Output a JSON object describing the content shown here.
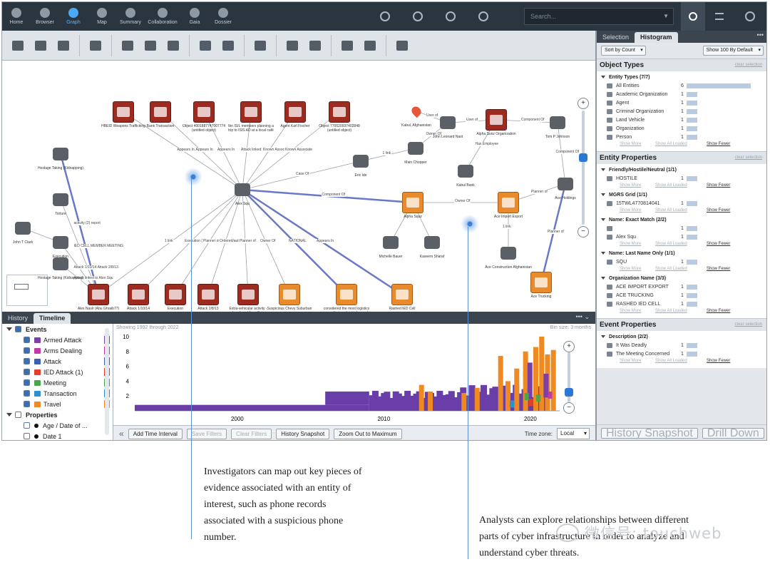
{
  "nav": {
    "items": [
      {
        "label": "Home",
        "icon": "home-icon"
      },
      {
        "label": "Browser",
        "icon": "browser-icon"
      },
      {
        "label": "Graph",
        "icon": "graph-icon",
        "active": true
      },
      {
        "label": "Map",
        "icon": "map-icon"
      },
      {
        "label": "Summary",
        "icon": "summary-icon"
      },
      {
        "label": "Collaboration",
        "icon": "collaboration-icon"
      },
      {
        "label": "Gaia",
        "icon": "gaia-icon"
      },
      {
        "label": "Dossier",
        "icon": "dossier-icon"
      }
    ],
    "search_placeholder": "Search..."
  },
  "graph": {
    "nodes": [
      {
        "id": "n1",
        "label": "HBEID Weapons Trafficking",
        "style": "red"
      },
      {
        "id": "n2",
        "label": "Bank Transaction",
        "style": "red"
      },
      {
        "id": "n3",
        "label": "Object 4001887747007774 (untitled object)",
        "style": "red"
      },
      {
        "id": "n4",
        "label": "Ibn ISIL members planning a trip to ISIS AD at a local café",
        "style": "red"
      },
      {
        "id": "n5",
        "label": "Agent Karl Fischer",
        "style": "red"
      },
      {
        "id": "n6",
        "label": "Object 770020937402848 (untitled object)",
        "style": "red"
      },
      {
        "id": "n7",
        "label": "Kabul, Afghanistan",
        "style": "pin"
      },
      {
        "id": "n8",
        "label": "John Leonard Nast",
        "style": "gray"
      },
      {
        "id": "n9",
        "label": "Alpha Sunz Organization",
        "style": "red"
      },
      {
        "id": "n10",
        "label": "Tom P Johnson",
        "style": "gray"
      },
      {
        "id": "n11",
        "label": "Main Chopper",
        "style": "gray"
      },
      {
        "id": "n12",
        "label": "Eric Ide",
        "style": "gray"
      },
      {
        "id": "n13",
        "label": "Kabul Bank",
        "style": "gray"
      },
      {
        "id": "n14",
        "label": "Ace Holdings",
        "style": "gray"
      },
      {
        "id": "n15",
        "label": "Hostage Taking (Kidnapping)",
        "style": "gray"
      },
      {
        "id": "n16",
        "label": "Torture",
        "style": "gray"
      },
      {
        "id": "n17",
        "label": "John T Clark",
        "style": "gray"
      },
      {
        "id": "n18",
        "label": "Execution",
        "style": "gray"
      },
      {
        "id": "n19",
        "label": "Hostage Taking (Kidnapping)",
        "style": "gray"
      },
      {
        "id": "n20",
        "label": "Alex Squ",
        "style": "gray"
      },
      {
        "id": "n21",
        "label": "Alex Nasir (Abu Ghraib77)",
        "style": "red"
      },
      {
        "id": "n22",
        "label": "Attack 1/10/14",
        "style": "red"
      },
      {
        "id": "n23",
        "label": "Execution",
        "style": "red"
      },
      {
        "id": "n24",
        "label": "Attack 2/8/13",
        "style": "red"
      },
      {
        "id": "n25",
        "label": "Extra-vehicular activity - abandoned from Extra vehicular activity",
        "style": "red"
      },
      {
        "id": "n26",
        "label": "Suspicious Chevy Suburban",
        "style": "org"
      },
      {
        "id": "n27",
        "label": "considered the most logistics coordinator of vehicles and explosive materials for manufacture by the rashed ied cell",
        "style": "org"
      },
      {
        "id": "n28",
        "label": "Rashed IED Cell",
        "style": "org"
      },
      {
        "id": "n29",
        "label": "Alpha Squz",
        "style": "org"
      },
      {
        "id": "n30",
        "label": "Ace Import Export",
        "style": "org"
      },
      {
        "id": "n31",
        "label": "Michelle Bauer",
        "style": "gray"
      },
      {
        "id": "n32",
        "label": "Kaseem Sharaf",
        "style": "gray"
      },
      {
        "id": "n33",
        "label": "Ace Construction Afghanistan",
        "style": "gray"
      },
      {
        "id": "n34",
        "label": "Ace Trucking",
        "style": "org"
      }
    ],
    "edge_labels": [
      {
        "label": "Appears In"
      },
      {
        "label": "Appears In"
      },
      {
        "label": "Appears In"
      },
      {
        "label": "Attack linked to (sic)"
      },
      {
        "label": "Known Associate"
      },
      {
        "label": "Known Associate"
      },
      {
        "label": "Case Of"
      },
      {
        "label": "1 link"
      },
      {
        "label": "Owner Of"
      },
      {
        "label": "User of"
      },
      {
        "label": "User of"
      },
      {
        "label": "Has Employee"
      },
      {
        "label": "Component Of"
      },
      {
        "label": "Component Of"
      },
      {
        "label": "Component Of"
      },
      {
        "label": "Owner Of"
      },
      {
        "label": "Planner of"
      },
      {
        "label": "1 link"
      },
      {
        "label": "Planner of"
      },
      {
        "label": "1 link"
      },
      {
        "label": "Execution (2)"
      },
      {
        "label": "Planner of"
      },
      {
        "label": "Ordered/authorized"
      },
      {
        "label": "Planner of"
      },
      {
        "label": "Owner Of"
      },
      {
        "label": "NATIONAL"
      },
      {
        "label": "Appears In"
      },
      {
        "label": "activity (2) report"
      },
      {
        "label": "IED CELL MEMBER MEETING"
      },
      {
        "label": "Attack 1/10/14 Attack 2/8/13"
      },
      {
        "label": "Attack linked to Alex Squ"
      }
    ]
  },
  "bottom_tabs": [
    {
      "label": "History"
    },
    {
      "label": "Timeline",
      "active": true
    }
  ],
  "events": {
    "header": "Events",
    "items": [
      {
        "label": "Armed Attack",
        "color": "#7b3fa6"
      },
      {
        "label": "Arms Dealing",
        "color": "#c23aa3"
      },
      {
        "label": "Attack",
        "color": "#3b5fb0"
      },
      {
        "label": "IED Attack (1)",
        "color": "#e33f2f"
      },
      {
        "label": "Meeting",
        "color": "#4aa84a"
      },
      {
        "label": "Transaction",
        "color": "#2d8fcf"
      },
      {
        "label": "Travel",
        "color": "#f08a20"
      }
    ],
    "properties_header": "Properties",
    "properties": [
      {
        "label": "Age / Date of ..."
      },
      {
        "label": "Date 1"
      }
    ]
  },
  "timeline": {
    "info": "Showing 1992 through 2022",
    "bin": "Bin size: 3 months",
    "buttons": [
      {
        "label": "Add Time Interval",
        "enabled": true
      },
      {
        "label": "Save Filters",
        "enabled": false
      },
      {
        "label": "Clear Filters",
        "enabled": false
      },
      {
        "label": "History Snapshot",
        "enabled": true
      },
      {
        "label": "Zoom Out to Maximum",
        "enabled": true
      }
    ],
    "timezone_label": "Time zone:",
    "timezone_value": "Local"
  },
  "chart_data": {
    "type": "bar",
    "x_ticks": [
      "2000",
      "2010",
      "2020"
    ],
    "y_ticks": [
      "2",
      "4",
      "6",
      "8",
      "10"
    ],
    "ylim": [
      0,
      10
    ]
  },
  "right_panel": {
    "tabs": [
      {
        "label": "Selection"
      },
      {
        "label": "Histogram",
        "active": true
      }
    ],
    "sort_label": "Sort by Count",
    "show_label": "Show 100 By Default",
    "show_more": "Show More",
    "show_all": "Show All Loaded",
    "show_fewer": "Show Fewer",
    "clear": "clear selection",
    "sections": [
      {
        "title": "Object Types",
        "groups": [
          {
            "title": "Entity Types (7/7)",
            "items": [
              {
                "label": "All Entities",
                "count": "6",
                "bar": 0.9
              },
              {
                "label": "Academic Organization",
                "count": "1",
                "bar": 0.15
              },
              {
                "label": "Agent",
                "count": "1",
                "bar": 0.15
              },
              {
                "label": "Criminal Organization",
                "count": "1",
                "bar": 0.15
              },
              {
                "label": "Land Vehicle",
                "count": "1",
                "bar": 0.15
              },
              {
                "label": "Organization",
                "count": "1",
                "bar": 0.15
              },
              {
                "label": "Person",
                "count": "1",
                "bar": 0.15
              }
            ]
          }
        ]
      },
      {
        "title": "Entity Properties",
        "groups": [
          {
            "title": "Friendly/Hostile/Neutral (1/1)",
            "items": [
              {
                "label": "HOSTILE",
                "count": "1",
                "bar": 0.15
              }
            ]
          },
          {
            "title": "MGRS Grid (1/1)",
            "items": [
              {
                "label": "15TWL4770814041",
                "count": "1",
                "bar": 0.15
              }
            ]
          },
          {
            "title": "Name: Exact Match (2/2)",
            "items": [
              {
                "label": "",
                "count": "1",
                "bar": 0.15
              },
              {
                "label": "Alex Squ",
                "count": "1",
                "bar": 0.15
              }
            ]
          },
          {
            "title": "Name: Last Name Only (1/1)",
            "items": [
              {
                "label": "SQU",
                "count": "1",
                "bar": 0.15
              }
            ]
          },
          {
            "title": "Organization Name (3/3)",
            "items": [
              {
                "label": "ACE IMPORT EXPORT",
                "count": "1",
                "bar": 0.15
              },
              {
                "label": "ACE TRUCKING",
                "count": "1",
                "bar": 0.15
              },
              {
                "label": "RASHED IED CELL",
                "count": "1",
                "bar": 0.15
              }
            ]
          }
        ]
      },
      {
        "title": "Event Properties",
        "groups": [
          {
            "title": "Description (2/2)",
            "items": [
              {
                "label": "It Was Deadly",
                "count": "1",
                "bar": 0.15
              },
              {
                "label": "The Meeting Concerned",
                "count": "1",
                "bar": 0.15
              }
            ]
          }
        ]
      }
    ],
    "bottom_buttons": [
      {
        "label": "History Snapshot",
        "enabled": false
      },
      {
        "label": "Drill Down",
        "enabled": false
      }
    ]
  },
  "captions": {
    "left": "Investigators can map out key pieces of evidence associated with an entity of interest, such as phone records associated with a suspicious phone number.",
    "right": "Analysts can explore relationships between different parts of cyber infrastructure in order to analyze and understand cyber threats.",
    "watermark": "微信号: touchweb"
  }
}
